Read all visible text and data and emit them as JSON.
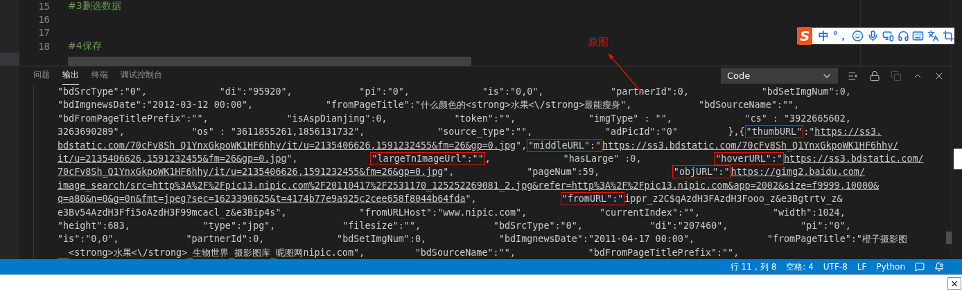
{
  "editor": {
    "lines": [
      {
        "number": "15",
        "text": "#3删选数据"
      },
      {
        "number": "16"
      },
      {
        "number": "17"
      },
      {
        "number": "18",
        "text": "#4保存"
      }
    ]
  },
  "ime_toolbar": {
    "logo": "S",
    "mode": "中",
    "punctuation": "°，"
  },
  "annotation": {
    "label": "原图"
  },
  "panel": {
    "tabs": [
      {
        "label": "问题",
        "selected": false
      },
      {
        "label": "输出",
        "selected": true
      },
      {
        "label": "终端",
        "selected": false
      },
      {
        "label": "调试控制台",
        "selected": false
      }
    ],
    "output_channel": "Code",
    "actions": [
      {
        "kind": "clear",
        "disabled": false
      },
      {
        "kind": "lock",
        "disabled": false
      },
      {
        "kind": "copy",
        "disabled": true
      },
      {
        "kind": "maximize",
        "disabled": false
      },
      {
        "kind": "close",
        "disabled": false
      }
    ],
    "lines": [
      {
        "segments": [
          {
            "kind": "plain",
            "text": "\"bdSrcType\":\"0\",             \"di\":\"95920\",            \"pi\":\"0\",             \"is\":\"0,0\",            \"partnerId\":0,             \"bdSetImgNum\":0,"
          }
        ]
      },
      {
        "segments": [
          {
            "kind": "plain",
            "text": "\"bdImgnewsDate\":\"2012-03-12 00:00\",             \"fromPageTitle\":\"什么颜色的<strong>水果<\\/strong>最能瘦身\",            \"bdSourceName\":\"\","
          }
        ]
      },
      {
        "segments": [
          {
            "kind": "plain",
            "text": "\"bdFromPageTitlePrefix\":\"\",              \"isAspDianjing\":0,            \"token\":\"\",             \"imgType\" : \"\",             \"cs\" : \"3922665602,"
          }
        ]
      },
      {
        "segments": [
          {
            "kind": "plain",
            "text": "3263690289\",            \"os\" : \"3611855261,1856131732\",             \"source_type\":\"\",             \"adPicId\":\"0\"         },{"
          },
          {
            "kind": "boxed",
            "text": "\"thumbURL\""
          },
          {
            "kind": "plain",
            "text": ":\""
          },
          {
            "kind": "link",
            "text": "https://ss3."
          }
        ]
      },
      {
        "segments": [
          {
            "kind": "link",
            "text": "bdstatic.com/70cFv8Sh_Q1YnxGkpoWK1HF6hhy/it/u=2135406626,1591232455&fm=26&gp=0.jpg"
          },
          {
            "kind": "plain",
            "text": "\","
          },
          {
            "kind": "boxed",
            "text": "\"middleURL\":\""
          },
          {
            "kind": "link",
            "text": "https://ss3.bdstatic.com/70cFv8Sh_Q1YnxGkpoWK1HF6hhy/"
          }
        ]
      },
      {
        "segments": [
          {
            "kind": "link",
            "text": "it/u=2135406626,1591232455&fm=26&gp=0.jpg"
          },
          {
            "kind": "plain",
            "text": "\",             "
          },
          {
            "kind": "boxed",
            "text": "\"largeTnImageUrl\":\"\""
          },
          {
            "kind": "plain",
            "text": ",             \"hasLarge\" :0,             "
          },
          {
            "kind": "boxed",
            "text": "\"hoverURL\":\""
          },
          {
            "kind": "link",
            "text": "https://ss3.bdstatic.com/"
          }
        ]
      },
      {
        "segments": [
          {
            "kind": "link",
            "text": "70cFv8Sh_Q1YnxGkpoWK1HF6hhy/it/u=2135406626,1591232455&fm=26&gp=0.jpg"
          },
          {
            "kind": "plain",
            "text": "\",             \"pageNum\":59,             "
          },
          {
            "kind": "boxed",
            "text": "\"objURL\":\""
          },
          {
            "kind": "link",
            "text": "https://gimg2.baidu.com/"
          }
        ]
      },
      {
        "segments": [
          {
            "kind": "link",
            "text": "image_search/src=http%3A%2F%2Fpic13.nipic.com%2F20110417%2F2531170_125252269081_2.jpg&refer=http%3A%2F%2Fpic13.nipic.com&app=2002&size=f9999,10000&"
          }
        ]
      },
      {
        "segments": [
          {
            "kind": "link",
            "text": "q=a80&n=0&g=0n&fmt=jpeg?sec=1623390625&t=4174b77e9a925c2cee658f8044b64fda"
          },
          {
            "kind": "plain",
            "text": "\",               "
          },
          {
            "kind": "boxed",
            "text": "\"fromURL\":\""
          },
          {
            "kind": "plain",
            "text": "ippr_z2C$qAzdH3FAzdH3Fooo_z&e3Bgtrtv_z&"
          }
        ]
      },
      {
        "segments": [
          {
            "kind": "plain",
            "text": "e3Bv54AzdH3Ffi5oAzdH3F99mcacl_z&e3Bip4s\",             \"fromURLHost\":\"www.nipic.com\",             \"currentIndex\":\"\",             \"width\":1024,"
          }
        ]
      },
      {
        "segments": [
          {
            "kind": "plain",
            "text": "\"height\":683,             \"type\":\"jpg\",            \"filesize\":\"\",             \"bdSrcType\":\"0\",            \"di\":\"207460\",             \"pi\":\"0\","
          }
        ]
      },
      {
        "segments": [
          {
            "kind": "plain",
            "text": "\"is\":\"0,0\",            \"partnerId\":0,             \"bdSetImgNum\":0,             \"bdImgnewsDate\":\"2011-04-17 00:00\",             \"fromPageTitle\":\"橙子摄影图"
          }
        ]
      },
      {
        "segments": [
          {
            "kind": "plain",
            "text": "__<strong>水果<\\/strong>_生物世界_摄影图库_昵图网nipic.com\",         \"bdSourceName\":\"\",             \"bdFromPageTitlePrefix\":\"\","
          }
        ]
      }
    ]
  },
  "status_bar": {
    "items": [
      "行 11，列 8",
      "空格: 4",
      "UTF-8",
      "LF",
      "Python"
    ]
  },
  "bottom_window": {
    "close": "×"
  }
}
